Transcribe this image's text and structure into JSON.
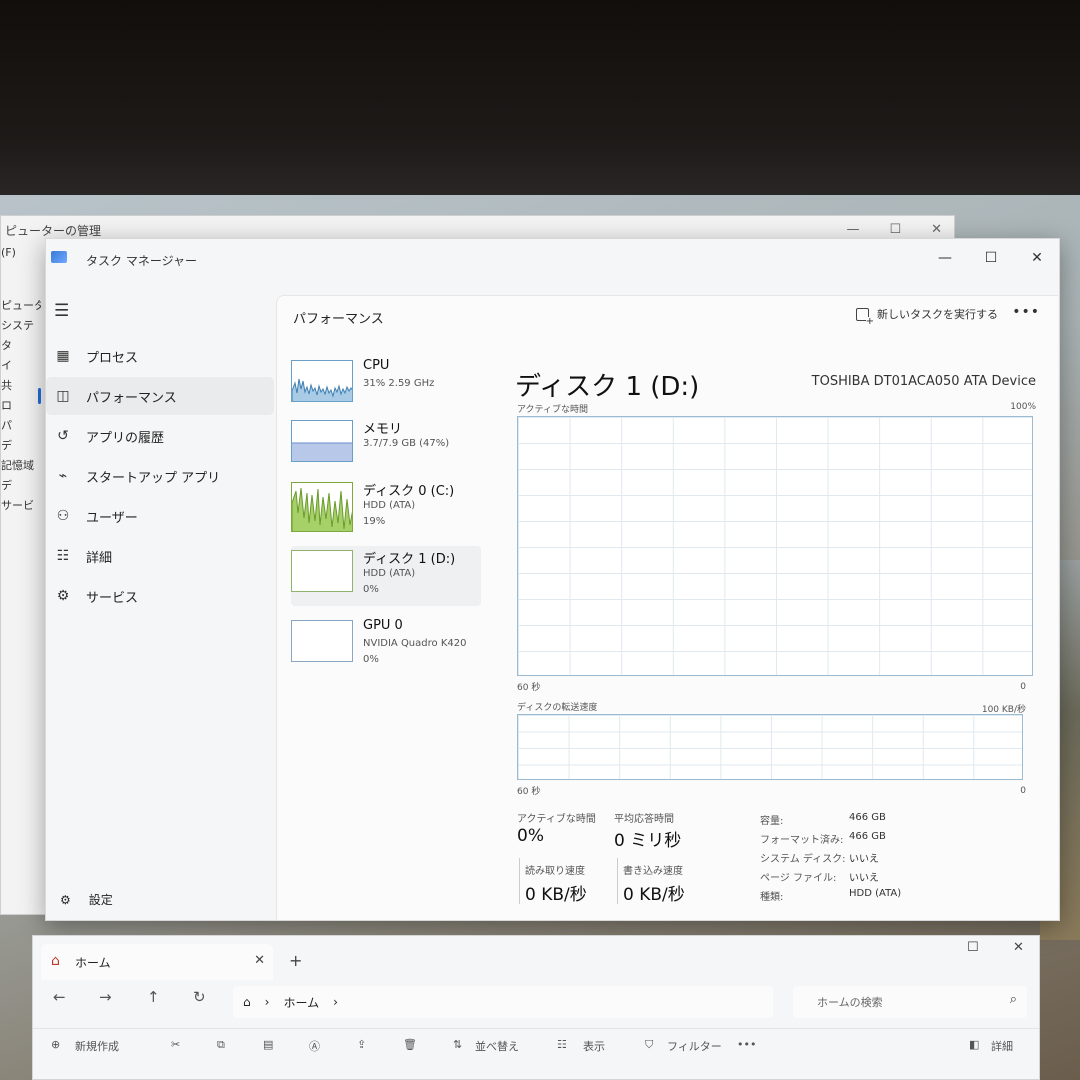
{
  "background_window": {
    "title": "ピューターの管理",
    "menu": "(F)",
    "tree": [
      "ピュータ",
      "システ",
      "タ",
      "イ",
      "共",
      "ロ",
      "パ",
      "デ",
      "記憶域",
      "デ",
      "サービ"
    ]
  },
  "task_manager": {
    "title": "タスク マネージャー",
    "nav": [
      {
        "label": "プロセス",
        "icon": "processes-icon"
      },
      {
        "label": "パフォーマンス",
        "icon": "performance-icon"
      },
      {
        "label": "アプリの履歴",
        "icon": "app-history-icon"
      },
      {
        "label": "スタートアップ アプリ",
        "icon": "startup-icon"
      },
      {
        "label": "ユーザー",
        "icon": "users-icon"
      },
      {
        "label": "詳細",
        "icon": "details-icon"
      },
      {
        "label": "サービス",
        "icon": "services-icon"
      }
    ],
    "settings_label": "設定",
    "content_title": "パフォーマンス",
    "run_new_task": "新しいタスクを実行する",
    "devices": [
      {
        "name": "CPU",
        "sub1": "31%  2.59 GHz",
        "sub2": ""
      },
      {
        "name": "メモリ",
        "sub1": "3.7/7.9 GB (47%)",
        "sub2": ""
      },
      {
        "name": "ディスク 0 (C:)",
        "sub1": "HDD (ATA)",
        "sub2": "19%"
      },
      {
        "name": "ディスク 1 (D:)",
        "sub1": "HDD (ATA)",
        "sub2": "0%"
      },
      {
        "name": "GPU 0",
        "sub1": "NVIDIA Quadro K420",
        "sub2": "0%"
      }
    ],
    "detail": {
      "title": "ディスク 1 (D:)",
      "model": "TOSHIBA DT01ACA050 ATA Device",
      "graph1": {
        "label": "アクティブな時間",
        "max": "100%",
        "time": "60 秒",
        "min": "0"
      },
      "graph2": {
        "label": "ディスクの転送速度",
        "max": "100 KB/秒",
        "time": "60 秒",
        "min": "0"
      },
      "stats": {
        "active_time_label": "アクティブな時間",
        "active_time": "0%",
        "avg_response_label": "平均応答時間",
        "avg_response": "0 ミリ秒",
        "read_label": "読み取り速度",
        "read": "0 KB/秒",
        "write_label": "書き込み速度",
        "write": "0 KB/秒"
      },
      "props": [
        {
          "k": "容量:",
          "v": "466 GB"
        },
        {
          "k": "フォーマット済み:",
          "v": "466 GB"
        },
        {
          "k": "システム ディスク:",
          "v": "いいえ"
        },
        {
          "k": "ページ ファイル:",
          "v": "いいえ"
        },
        {
          "k": "種類:",
          "v": "HDD (ATA)"
        }
      ]
    }
  },
  "explorer": {
    "tab_title": "ホーム",
    "breadcrumb": "ホーム",
    "search_placeholder": "ホームの検索",
    "commands": {
      "new": "新規作成",
      "sort": "並べ替え",
      "view": "表示",
      "filter": "フィルター",
      "details": "詳細"
    }
  },
  "colors": {
    "accent": "#1f5fbf",
    "graph_border": "#9cbad0",
    "cpu_fill": "#3d7fb0",
    "disk0_fill": "#8bbf4a"
  }
}
